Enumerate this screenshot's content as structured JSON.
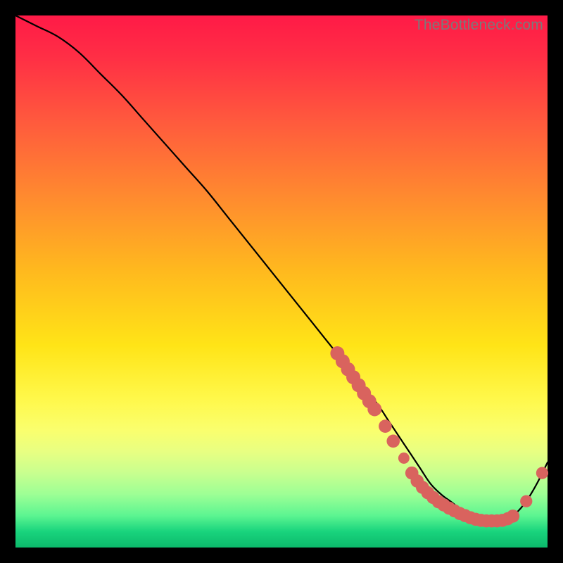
{
  "watermark": "TheBottleneck.com",
  "colors": {
    "marker": "#d9635e",
    "curve": "#000000",
    "gradient_top": "#ff1a47",
    "gradient_mid": "#ffe417",
    "gradient_bottom": "#0cb96b",
    "page_bg": "#000000"
  },
  "chart_data": {
    "type": "line",
    "title": "",
    "xlabel": "",
    "ylabel": "",
    "xlim": [
      0,
      100
    ],
    "ylim": [
      0,
      100
    ],
    "series": [
      {
        "name": "bottleneck-curve",
        "x": [
          0,
          4,
          8,
          12,
          16,
          20,
          24,
          28,
          32,
          36,
          40,
          44,
          48,
          52,
          56,
          60,
          64,
          68,
          70,
          72,
          74,
          76,
          78,
          80,
          82,
          84,
          86,
          88,
          90,
          92,
          94,
          96,
          98,
          100
        ],
        "y": [
          100,
          98,
          96,
          93,
          89,
          85,
          80.5,
          76,
          71.5,
          67,
          62,
          57,
          52,
          47,
          42,
          37,
          32,
          27,
          24,
          21,
          18,
          15,
          12,
          10,
          8.5,
          7,
          6,
          5.2,
          5,
          5.3,
          6.4,
          8.7,
          12,
          16
        ]
      }
    ],
    "markers": [
      {
        "x": 60.5,
        "y": 36.5,
        "r": 1.0
      },
      {
        "x": 61.5,
        "y": 35.0,
        "r": 1.0
      },
      {
        "x": 62.5,
        "y": 33.5,
        "r": 1.0
      },
      {
        "x": 63.5,
        "y": 32.0,
        "r": 1.0
      },
      {
        "x": 64.5,
        "y": 30.5,
        "r": 1.0
      },
      {
        "x": 65.5,
        "y": 29.0,
        "r": 1.0
      },
      {
        "x": 66.5,
        "y": 27.5,
        "r": 1.0
      },
      {
        "x": 67.5,
        "y": 26.0,
        "r": 1.0
      },
      {
        "x": 69.5,
        "y": 22.8,
        "r": 0.9
      },
      {
        "x": 71.0,
        "y": 20.0,
        "r": 0.9
      },
      {
        "x": 73.0,
        "y": 16.8,
        "r": 0.7
      },
      {
        "x": 74.5,
        "y": 14.0,
        "r": 0.9
      },
      {
        "x": 75.5,
        "y": 12.5,
        "r": 0.9
      },
      {
        "x": 76.5,
        "y": 11.3,
        "r": 0.9
      },
      {
        "x": 77.5,
        "y": 10.3,
        "r": 0.9
      },
      {
        "x": 78.5,
        "y": 9.4,
        "r": 0.9
      },
      {
        "x": 79.5,
        "y": 8.6,
        "r": 0.9
      },
      {
        "x": 80.5,
        "y": 8.0,
        "r": 0.9
      },
      {
        "x": 81.5,
        "y": 7.4,
        "r": 0.9
      },
      {
        "x": 82.5,
        "y": 6.9,
        "r": 0.9
      },
      {
        "x": 83.5,
        "y": 6.4,
        "r": 0.9
      },
      {
        "x": 84.5,
        "y": 6.0,
        "r": 0.9
      },
      {
        "x": 85.5,
        "y": 5.6,
        "r": 0.9
      },
      {
        "x": 86.5,
        "y": 5.3,
        "r": 0.9
      },
      {
        "x": 87.5,
        "y": 5.1,
        "r": 0.9
      },
      {
        "x": 88.5,
        "y": 5.0,
        "r": 0.9
      },
      {
        "x": 89.5,
        "y": 5.0,
        "r": 0.9
      },
      {
        "x": 90.5,
        "y": 5.0,
        "r": 0.9
      },
      {
        "x": 91.5,
        "y": 5.1,
        "r": 0.9
      },
      {
        "x": 92.5,
        "y": 5.4,
        "r": 0.9
      },
      {
        "x": 93.5,
        "y": 5.9,
        "r": 0.9
      },
      {
        "x": 96.0,
        "y": 8.7,
        "r": 0.8
      },
      {
        "x": 99.0,
        "y": 14.0,
        "r": 0.8
      }
    ],
    "note": "Axes are unlabeled in source; x and y normalized 0-100. Curve shows a bottleneck dip near x≈89."
  }
}
